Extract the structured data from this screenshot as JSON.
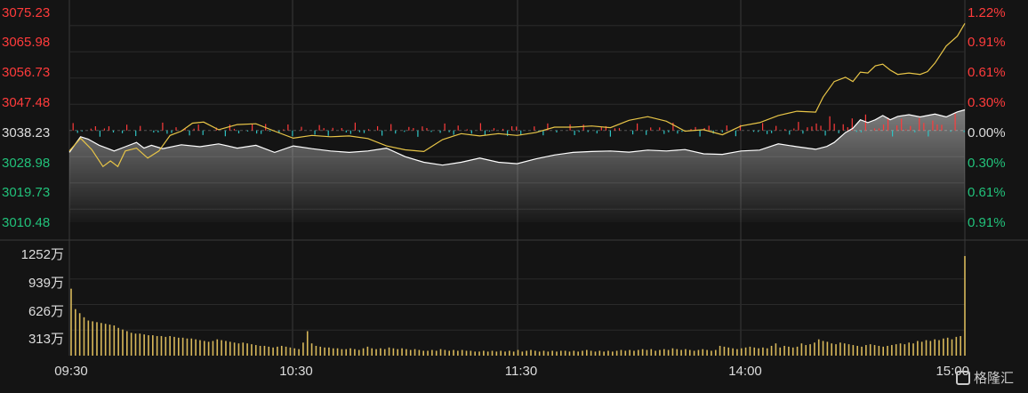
{
  "chart_data": [
    {
      "type": "line",
      "title": "",
      "ylim": [
        3005.85,
        3079.85
      ],
      "y_ticks_left": [
        "3075.23",
        "3065.98",
        "3056.73",
        "3047.48",
        "3038.23",
        "3028.98",
        "3019.73",
        "3010.48"
      ],
      "y_ticks_right": [
        "1.22%",
        "0.91%",
        "0.61%",
        "0.30%",
        "0.00%",
        "0.30%",
        "0.61%",
        "0.91%"
      ],
      "baseline": 3038.23,
      "colors": {
        "up": "#ff3b3b",
        "down": "#21c17a",
        "neutral": "#dddddd",
        "price": "#ffffff",
        "avg": "#e8c547",
        "bg": "#141414",
        "grid": "#333333"
      },
      "series": [
        {
          "role": "price",
          "points": [
            [
              0,
              3030.5
            ],
            [
              3,
              3036.0
            ],
            [
              5,
              3035.2
            ],
            [
              8,
              3033.0
            ],
            [
              10,
              3032.0
            ],
            [
              12,
              3031.0
            ],
            [
              15,
              3032.5
            ],
            [
              18,
              3034.0
            ],
            [
              20,
              3032.0
            ],
            [
              22,
              3033.0
            ],
            [
              25,
              3031.8
            ],
            [
              30,
              3033.2
            ],
            [
              35,
              3032.5
            ],
            [
              40,
              3033.5
            ],
            [
              45,
              3032.0
            ],
            [
              50,
              3033.0
            ],
            [
              55,
              3030.5
            ],
            [
              60,
              3032.8
            ],
            [
              65,
              3031.8
            ],
            [
              70,
              3031.0
            ],
            [
              75,
              3030.5
            ],
            [
              80,
              3031.0
            ],
            [
              85,
              3032.0
            ],
            [
              90,
              3029.0
            ],
            [
              95,
              3027.0
            ],
            [
              100,
              3026.0
            ],
            [
              105,
              3027.0
            ],
            [
              110,
              3028.5
            ],
            [
              115,
              3027.0
            ],
            [
              120,
              3026.5
            ],
            [
              125,
              3028.2
            ],
            [
              130,
              3029.6
            ],
            [
              135,
              3030.5
            ],
            [
              140,
              3030.8
            ],
            [
              145,
              3031.0
            ],
            [
              150,
              3030.6
            ],
            [
              155,
              3031.3
            ],
            [
              160,
              3031.0
            ],
            [
              165,
              3031.5
            ],
            [
              170,
              3030.0
            ],
            [
              175,
              3029.8
            ],
            [
              180,
              3031.0
            ],
            [
              185,
              3031.3
            ],
            [
              190,
              3033.5
            ],
            [
              195,
              3032.5
            ],
            [
              200,
              3031.6
            ],
            [
              203,
              3032.6
            ],
            [
              205,
              3034.0
            ],
            [
              208,
              3037.5
            ],
            [
              210,
              3039.0
            ],
            [
              212,
              3042.0
            ],
            [
              214,
              3041.0
            ],
            [
              216,
              3042.0
            ],
            [
              218,
              3043.5
            ],
            [
              220,
              3042.0
            ],
            [
              222,
              3043.2
            ],
            [
              225,
              3043.8
            ],
            [
              228,
              3043.0
            ],
            [
              230,
              3043.5
            ],
            [
              232,
              3044.0
            ],
            [
              235,
              3043.0
            ],
            [
              238,
              3044.8
            ],
            [
              240,
              3045.5
            ]
          ]
        },
        {
          "role": "average",
          "points": [
            [
              0,
              3031.0
            ],
            [
              3,
              3035.5
            ],
            [
              6,
              3031.5
            ],
            [
              9,
              3025.5
            ],
            [
              11,
              3027.5
            ],
            [
              13,
              3025.5
            ],
            [
              15,
              3031.0
            ],
            [
              18,
              3032.0
            ],
            [
              21,
              3028.5
            ],
            [
              24,
              3031.0
            ],
            [
              27,
              3036.5
            ],
            [
              30,
              3038.0
            ],
            [
              33,
              3040.8
            ],
            [
              36,
              3041.2
            ],
            [
              40,
              3038.5
            ],
            [
              45,
              3040.3
            ],
            [
              50,
              3040.6
            ],
            [
              55,
              3038.0
            ],
            [
              60,
              3035.5
            ],
            [
              65,
              3036.5
            ],
            [
              70,
              3036.0
            ],
            [
              75,
              3036.3
            ],
            [
              80,
              3035.4
            ],
            [
              85,
              3032.8
            ],
            [
              90,
              3031.4
            ],
            [
              95,
              3030.8
            ],
            [
              100,
              3035.0
            ],
            [
              105,
              3037.1
            ],
            [
              110,
              3036.3
            ],
            [
              115,
              3037.1
            ],
            [
              120,
              3036.5
            ],
            [
              125,
              3037.5
            ],
            [
              130,
              3039.4
            ],
            [
              135,
              3039.4
            ],
            [
              140,
              3039.8
            ],
            [
              145,
              3039.2
            ],
            [
              150,
              3041.8
            ],
            [
              155,
              3043.1
            ],
            [
              160,
              3041.5
            ],
            [
              165,
              3038.0
            ],
            [
              170,
              3038.5
            ],
            [
              175,
              3036.7
            ],
            [
              180,
              3039.8
            ],
            [
              185,
              3041.0
            ],
            [
              190,
              3043.5
            ],
            [
              195,
              3045.0
            ],
            [
              200,
              3044.7
            ],
            [
              202,
              3050.0
            ],
            [
              205,
              3055.5
            ],
            [
              208,
              3057.0
            ],
            [
              210,
              3055.5
            ],
            [
              212,
              3058.8
            ],
            [
              214,
              3058.5
            ],
            [
              216,
              3061.0
            ],
            [
              218,
              3061.6
            ],
            [
              220,
              3059.5
            ],
            [
              222,
              3058.0
            ],
            [
              225,
              3058.5
            ],
            [
              228,
              3058.0
            ],
            [
              230,
              3059.0
            ],
            [
              232,
              3062.0
            ],
            [
              235,
              3068.0
            ],
            [
              238,
              3071.5
            ],
            [
              240,
              3076.0
            ]
          ]
        }
      ]
    },
    {
      "type": "bar",
      "ylabel_ticks": [
        "1252万",
        "939万",
        "626万",
        "313万"
      ],
      "ylim": [
        0,
        1252
      ],
      "x_ticks": [
        "09:30",
        "10:30",
        "11:30",
        "14:00",
        "15:00"
      ],
      "values": [
        820,
        570,
        520,
        470,
        430,
        420,
        410,
        400,
        390,
        380,
        370,
        340,
        320,
        300,
        280,
        270,
        270,
        260,
        250,
        250,
        240,
        240,
        230,
        240,
        230,
        220,
        220,
        210,
        210,
        200,
        190,
        180,
        170,
        180,
        200,
        190,
        180,
        170,
        160,
        150,
        160,
        150,
        140,
        130,
        120,
        120,
        110,
        100,
        110,
        120,
        110,
        100,
        90,
        80,
        160,
        300,
        150,
        120,
        110,
        100,
        100,
        90,
        90,
        80,
        80,
        90,
        80,
        70,
        90,
        110,
        90,
        80,
        90,
        80,
        100,
        90,
        80,
        90,
        80,
        70,
        80,
        70,
        60,
        60,
        70,
        60,
        80,
        70,
        60,
        70,
        60,
        70,
        60,
        60,
        50,
        50,
        60,
        50,
        60,
        50,
        60,
        50,
        60,
        50,
        70,
        50,
        60,
        70,
        60,
        50,
        60,
        50,
        60,
        50,
        60,
        60,
        50,
        60,
        50,
        60,
        70,
        60,
        50,
        60,
        50,
        60,
        50,
        60,
        70,
        60,
        70,
        60,
        70,
        80,
        70,
        80,
        60,
        70,
        80,
        70,
        90,
        80,
        70,
        80,
        70,
        60,
        70,
        80,
        70,
        60,
        70,
        120,
        110,
        100,
        90,
        80,
        90,
        100,
        110,
        100,
        90,
        100,
        90,
        120,
        150,
        100,
        120,
        110,
        100,
        110,
        150,
        130,
        140,
        160,
        200,
        180,
        170,
        150,
        140,
        160,
        150,
        140,
        130,
        120,
        110,
        130,
        140,
        130,
        120,
        110,
        120,
        130,
        140,
        150,
        140,
        160,
        150,
        180,
        170,
        190,
        180,
        200,
        190,
        210,
        220,
        200,
        230,
        240,
        1220
      ]
    }
  ],
  "watermark": "格隆汇"
}
